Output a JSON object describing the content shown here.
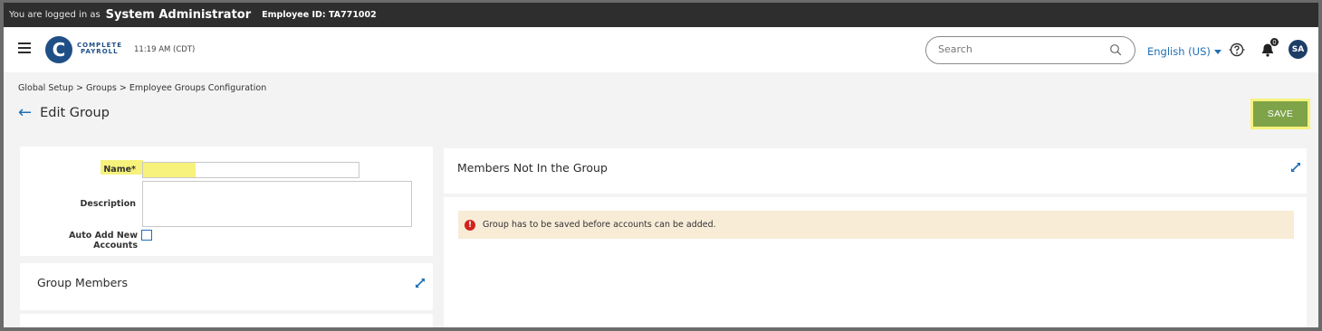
{
  "topbar": {
    "logged_in_prefix": "You are logged in as",
    "user_name": "System Administrator",
    "employee_id": "Employee ID: TA771002"
  },
  "header": {
    "logo_letter": "C",
    "logo_line1": "COMPLETE",
    "logo_line2": "PAYROLL",
    "time": "11:19 AM (CDT)",
    "search_placeholder": "Search",
    "language": "English (US)",
    "notification_count": "0",
    "avatar_initials": "SA"
  },
  "breadcrumb": "Global Setup > Groups > Employee Groups Configuration",
  "page": {
    "back_glyph": "←",
    "title": "Edit Group",
    "save_label": "SAVE"
  },
  "form": {
    "name_label": "Name*",
    "name_value": "",
    "description_label": "Description",
    "description_value": "",
    "auto_add_label": "Auto Add New Accounts",
    "auto_add_checked": false
  },
  "group_members": {
    "title": "Group Members"
  },
  "members_not_in_group": {
    "title": "Members Not In the Group",
    "alert_icon": "!",
    "alert_message": "Group has to be saved before accounts can be added."
  },
  "colors": {
    "accent_blue": "#1f6fb4",
    "save_green": "#7ea348",
    "highlight_yellow": "#f6f27c",
    "alert_bg": "#f8ecd7",
    "alert_red": "#d0241d",
    "topbar_dark": "#2e2e2e"
  },
  "icons": [
    "hamburger-icon",
    "search-icon",
    "caret-down-icon",
    "help-icon",
    "bell-icon",
    "back-arrow-icon",
    "expand-icon",
    "error-icon"
  ]
}
